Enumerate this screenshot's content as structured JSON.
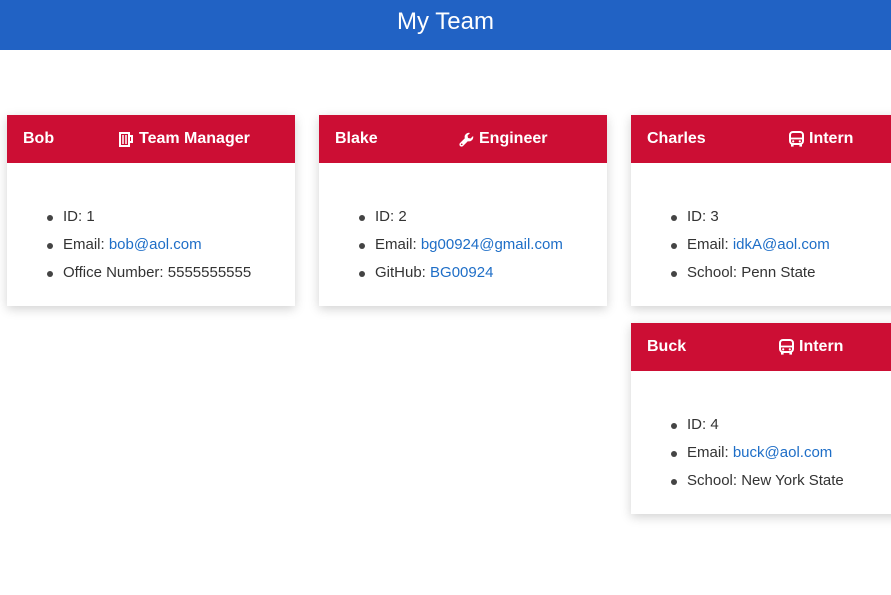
{
  "header": {
    "title": "My Team"
  },
  "colors": {
    "header_bg": "#2162c4",
    "card_head_bg": "#cc0e34",
    "link": "#1e6ec7"
  },
  "cards": [
    {
      "name": "Bob",
      "role": "Team Manager",
      "role_icon": "mug-icon",
      "id_label": "ID: ",
      "id": "1",
      "email_label": "Email: ",
      "email": "bob@aol.com",
      "extra_label": "Office Number: ",
      "extra": "5555555555"
    },
    {
      "name": "Blake",
      "role": "Engineer",
      "role_icon": "wrench-icon",
      "id_label": "ID: ",
      "id": "2",
      "email_label": "Email: ",
      "email": "bg00924@gmail.com",
      "extra_label": "GitHub: ",
      "extra": "BG00924"
    },
    {
      "name": "Charles",
      "role": "Intern",
      "role_icon": "bus-icon",
      "id_label": "ID: ",
      "id": "3",
      "email_label": "Email: ",
      "email": "idkA@aol.com",
      "extra_label": "School: ",
      "extra": "Penn State"
    },
    {
      "name": "Buck",
      "role": "Intern",
      "role_icon": "bus-icon",
      "id_label": "ID: ",
      "id": "4",
      "email_label": "Email: ",
      "email": "buck@aol.com",
      "extra_label": "School: ",
      "extra": "New York State"
    }
  ]
}
